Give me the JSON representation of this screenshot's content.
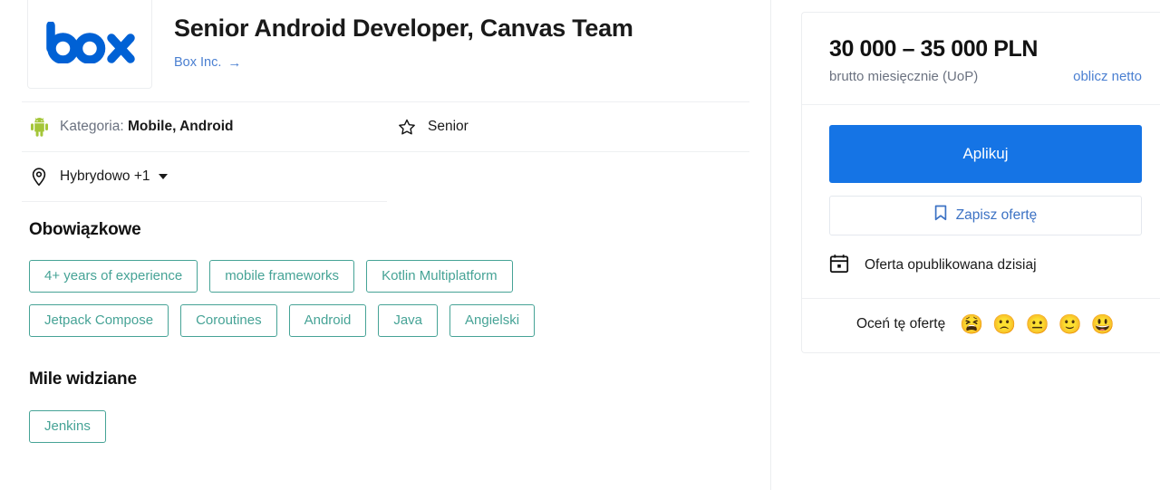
{
  "header": {
    "company_logo_alt": "box",
    "job_title": "Senior Android Developer, Canvas Team",
    "company_link": "Box Inc.",
    "company_link_arrow": "→"
  },
  "meta": {
    "category_label": "Kategoria:",
    "category_value": "Mobile, Android",
    "seniority": "Senior",
    "location": "Hybrydowo +1"
  },
  "skills": {
    "required_title": "Obowiązkowe",
    "required_tags": [
      "4+ years of experience",
      "mobile frameworks",
      "Kotlin Multiplatform",
      "Jetpack Compose",
      "Coroutines",
      "Android",
      "Java",
      "Angielski"
    ],
    "nice_title": "Mile widziane",
    "nice_tags": [
      "Jenkins"
    ]
  },
  "sidebar": {
    "salary_amount": "30 000 – 35 000 PLN",
    "salary_subtitle": "brutto miesięcznie (UoP)",
    "net_calc_link": "oblicz netto",
    "apply_label": "Aplikuj",
    "save_label": "Zapisz ofertę",
    "published_label": "Oferta opublikowana dzisiaj",
    "rate_label": "Oceń tę ofertę",
    "emojis": [
      "😫",
      "🙁",
      "😐",
      "🙂",
      "😃"
    ]
  },
  "colors": {
    "brand_blue": "#1574e5",
    "logo_blue": "#0061d5",
    "link_blue": "#4a7fd1",
    "tag_teal": "#46a396",
    "android_green": "#a4c639",
    "text_dark": "#121212",
    "text_muted": "#6b7280",
    "border_gray": "#eceef0"
  }
}
